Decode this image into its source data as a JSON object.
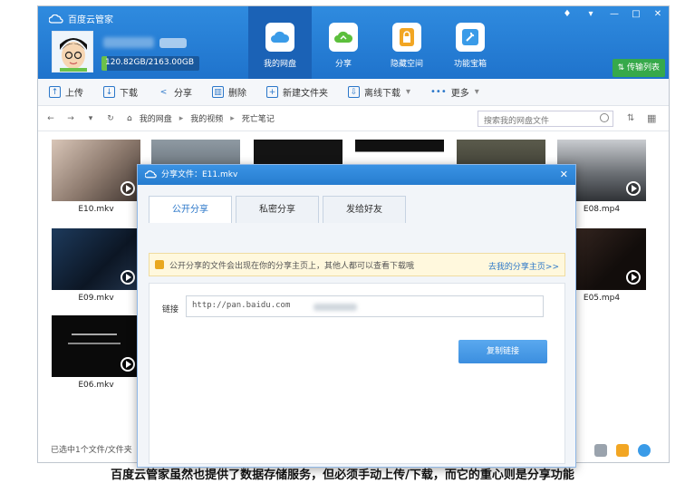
{
  "app": {
    "title": "百度云管家"
  },
  "user": {
    "quota_text": "120.82GB/2163.00GB",
    "quota_fraction": 0.056
  },
  "nav": [
    {
      "label": "我的网盘",
      "icon": "cloud-icon",
      "color": "#3a9be8"
    },
    {
      "label": "分享",
      "icon": "share-icon",
      "color": "#5cbf3c"
    },
    {
      "label": "隐藏空间",
      "icon": "lock-icon",
      "color": "#f2a623"
    },
    {
      "label": "功能宝箱",
      "icon": "wrench-icon",
      "color": "#3a9be8"
    }
  ],
  "window": {
    "transfer_label": "传输列表"
  },
  "toolbar": {
    "upload": "上传",
    "download": "下载",
    "share": "分享",
    "delete": "删除",
    "new_folder": "新建文件夹",
    "offline_download": "离线下载",
    "more": "更多"
  },
  "path": {
    "crumbs": [
      "我的网盘",
      "我的视频",
      "死亡笔记"
    ],
    "search_placeholder": "搜索我的网盘文件"
  },
  "files": [
    {
      "name": "E10.mkv"
    },
    {
      "name": "E08.mp4"
    },
    {
      "name": "E09.mkv"
    },
    {
      "name": "E05.mp4"
    },
    {
      "name": "E06.mkv"
    }
  ],
  "status": {
    "text": "已选中1个文件/文件夹"
  },
  "dialog": {
    "title": "分享文件：E11.mkv",
    "tabs": [
      "公开分享",
      "私密分享",
      "发给好友"
    ],
    "notice": "公开分享的文件会出现在你的分享主页上，其他人都可以查看下载哦",
    "notice_link": "去我的分享主页>>",
    "link_label": "链接",
    "link_value": "http://pan.baidu.com",
    "copy_button": "复制链接"
  },
  "caption": "百度云管家虽然也提供了数据存储服务，但必须手动上传/下载，而它的重心则是分享功能"
}
